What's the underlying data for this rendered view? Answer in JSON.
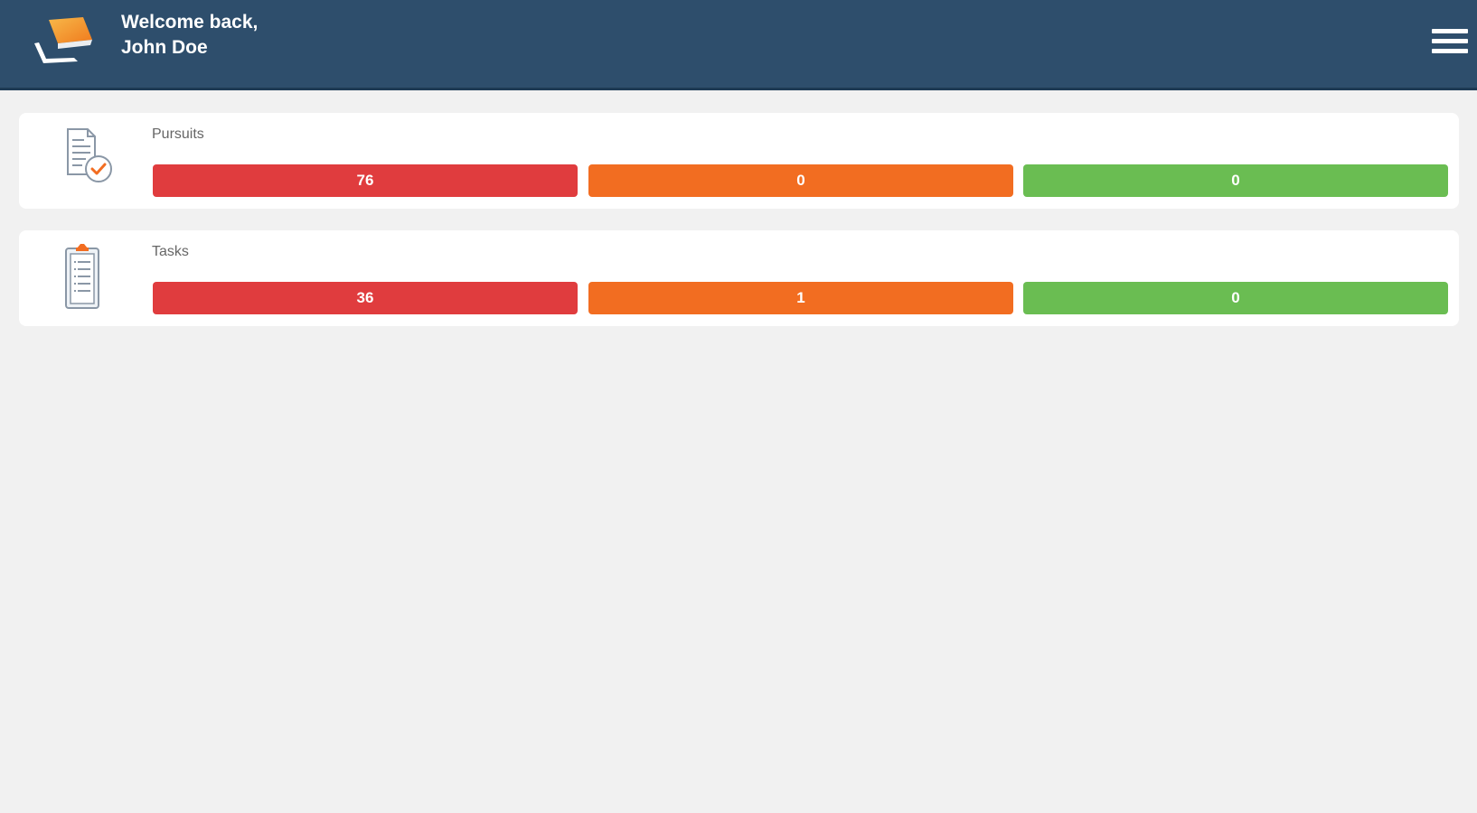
{
  "header": {
    "logo_icon": "book-logo-icon",
    "greeting_line1": "Welcome back,",
    "greeting_line2": "John Doe",
    "menu_icon": "hamburger-menu-icon"
  },
  "colors": {
    "header_bg": "#2e4e6c",
    "overdue": "#e03c3e",
    "due": "#f26d21",
    "complete": "#6abd52",
    "background": "#f1f1f1"
  },
  "cards": [
    {
      "label": "Pursuits",
      "icon": "document-check-icon",
      "counts": {
        "red": "76",
        "orange": "0",
        "green": "0"
      }
    },
    {
      "label": "Tasks",
      "icon": "clipboard-icon",
      "counts": {
        "red": "36",
        "orange": "1",
        "green": "0"
      }
    }
  ]
}
